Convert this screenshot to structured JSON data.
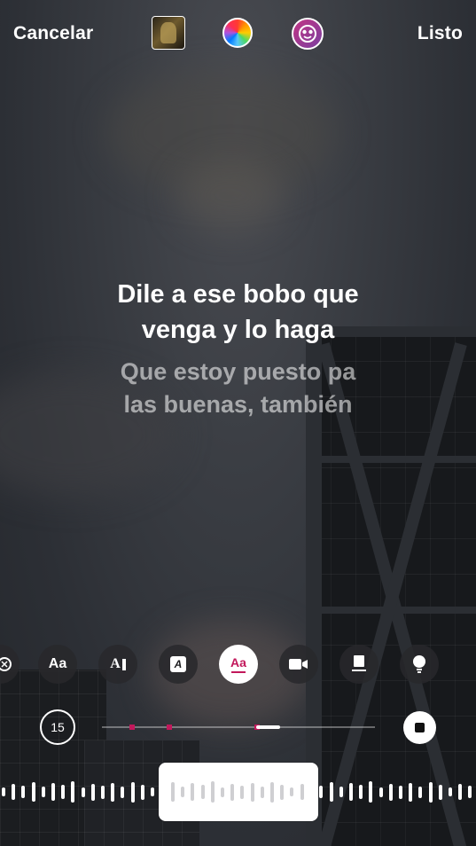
{
  "topbar": {
    "cancel_label": "Cancelar",
    "done_label": "Listo",
    "icons": [
      "album-cover-thumbnail",
      "color-wheel-icon",
      "sticker-effect-icon"
    ]
  },
  "lyrics": {
    "active_line1": "Dile a ese bobo que",
    "active_line2": "venga y lo haga",
    "next_line1": "Que estoy puesto pa",
    "next_line2": "las buenas, también"
  },
  "style_options": {
    "labels": [
      "Aa",
      "A",
      "A",
      "Aa"
    ],
    "selected": "Aa",
    "icons": [
      "partial-icon",
      "text-size-icon",
      "text-bar-icon",
      "text-box-icon",
      "text-underline-icon",
      "video-icon",
      "card-icon",
      "bulb-icon"
    ]
  },
  "timeline": {
    "duration": "15"
  },
  "colors": {
    "accent": "#c2185b",
    "text": "#ffffff"
  }
}
